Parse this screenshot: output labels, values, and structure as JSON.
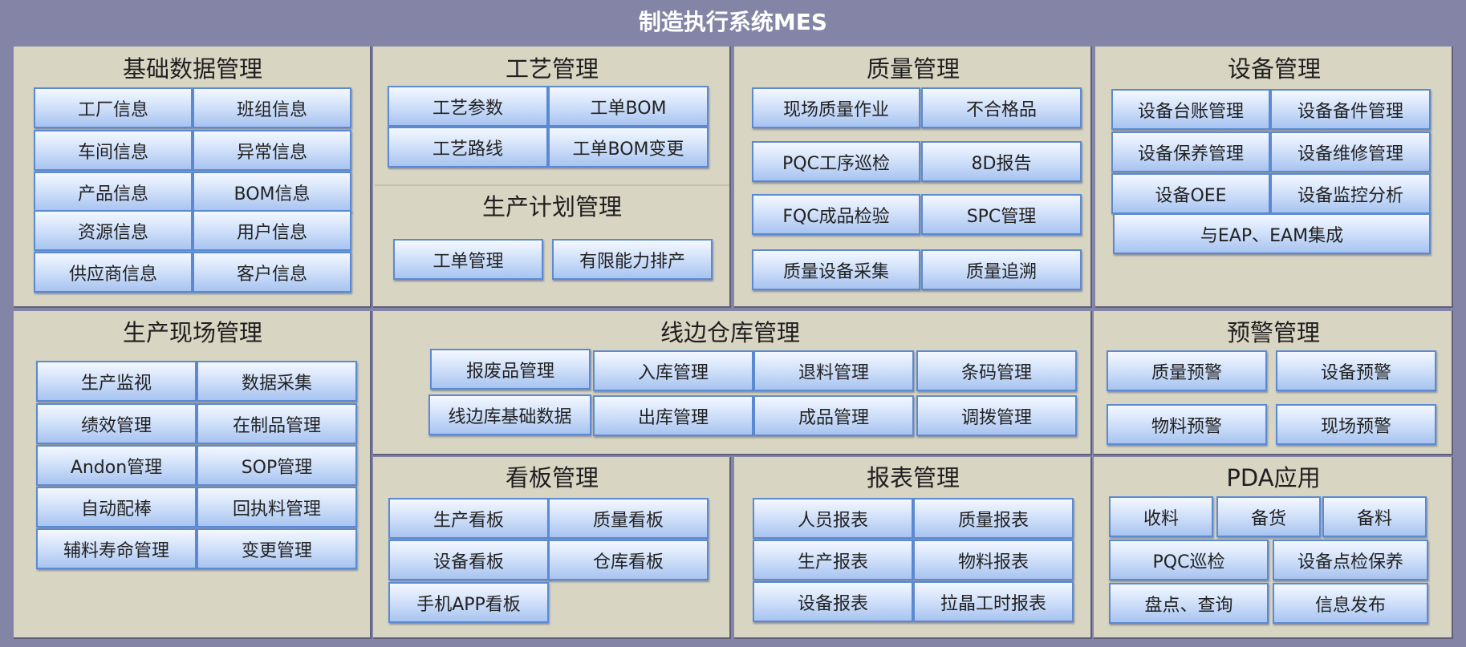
{
  "title": "制造执行系统MES",
  "panels": [
    {
      "title": "基础数据管理",
      "items": [
        "工厂信息",
        "班组信息",
        "车间信息",
        "异常信息",
        "产品信息",
        "BOM信息",
        "资源信息",
        "用户信息",
        "供应商信息",
        "客户信息"
      ]
    },
    {
      "title": "工艺管理",
      "items": [
        "工艺参数",
        "工单BOM",
        "工艺路线",
        "工单BOM变更"
      ]
    },
    {
      "title": "生产计划管理",
      "items": [
        "工单管理",
        "有限能力排产"
      ]
    },
    {
      "title": "质量管理",
      "items": [
        "现场质量作业",
        "不合格品",
        "PQC工序巡检",
        "8D报告",
        "FQC成品检验",
        "SPC管理",
        "质量设备采集",
        "质量追溯"
      ]
    },
    {
      "title": "设备管理",
      "items": [
        "设备台账管理",
        "设备备件管理",
        "设备保养管理",
        "设备维修管理",
        "设备OEE",
        "设备监控分析",
        "与EAP、EAM集成"
      ]
    },
    {
      "title": "生产现场管理",
      "items": [
        "生产监视",
        "数据采集",
        "绩效管理",
        "在制品管理",
        "Andon管理",
        "SOP管理",
        "自动配棒",
        "回执料管理",
        "辅料寿命管理",
        "变更管理"
      ]
    },
    {
      "title": "线边仓库管理",
      "items": [
        "报废品管理",
        "入库管理",
        "退料管理",
        "条码管理",
        "线边库基础数据",
        "出库管理",
        "成品管理",
        "调拨管理"
      ]
    },
    {
      "title": "预警管理",
      "items": [
        "质量预警",
        "设备预警",
        "物料预警",
        "现场预警"
      ]
    },
    {
      "title": "看板管理",
      "items": [
        "生产看板",
        "质量看板",
        "设备看板",
        "仓库看板",
        "手机APP看板"
      ]
    },
    {
      "title": "报表管理",
      "items": [
        "人员报表",
        "质量报表",
        "生产报表",
        "物料报表",
        "设备报表",
        "拉晶工时报表"
      ]
    },
    {
      "title": "PDA应用",
      "items": [
        "收料",
        "备货",
        "备料",
        "PQC巡检",
        "设备点检保养",
        "盘点、查询",
        "信息发布"
      ]
    }
  ]
}
